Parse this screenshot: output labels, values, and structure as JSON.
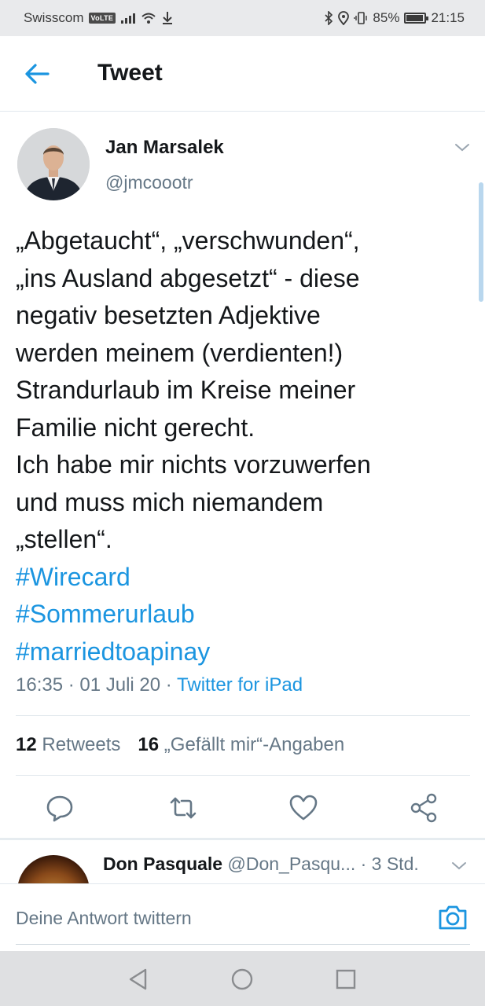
{
  "status_bar": {
    "carrier": "Swisscom",
    "volte": "VoLTE",
    "battery": "85%",
    "battery_level": 0.85,
    "time": "21:15"
  },
  "header": {
    "title": "Tweet"
  },
  "tweet": {
    "author_name": "Jan Marsalek",
    "author_handle": "@jmcoootr",
    "text_lines": [
      "„Abgetaucht“, „verschwunden“,",
      "„ins Ausland abgesetzt“ - diese",
      "negativ besetzten Adjektive",
      "werden meinem (verdienten!)",
      "Strandurlaub im Kreise meiner",
      "Familie nicht gerecht.",
      "Ich habe mir nichts vorzuwerfen",
      "und muss mich niemandem",
      "„stellen“."
    ],
    "hashtags": [
      "#Wirecard",
      "#Sommerurlaub",
      "#marriedtoapinay"
    ],
    "timestamp": "16:35 · 01 Juli 20 · ",
    "source": "Twitter for iPad",
    "retweets_count": "12",
    "retweets_label": "Retweets",
    "likes_count": "16",
    "likes_label": "„Gefällt mir“-Angaben"
  },
  "actions": [
    "reply-icon",
    "retweet-icon",
    "like-icon",
    "share-icon"
  ],
  "reply_preview": {
    "name": "Don Pasquale",
    "handle": "@Don_Pasqu...",
    "time": " · 3 Std."
  },
  "compose": {
    "placeholder": "Deine Antwort twittern"
  },
  "colors": {
    "accent": "#1b95e0",
    "text": "#14171a",
    "secondary": "#657786"
  }
}
